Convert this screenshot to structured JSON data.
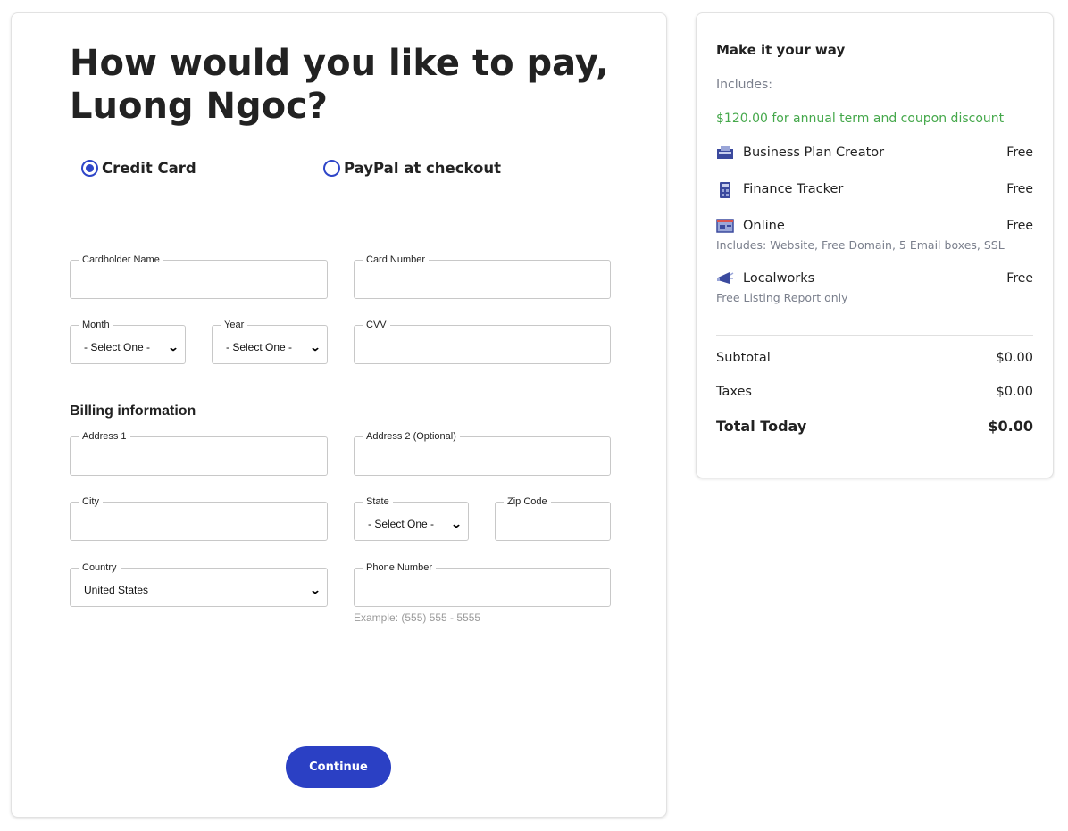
{
  "payment": {
    "title": "How would you like to pay, Luong Ngoc?",
    "methods": [
      {
        "label": "Credit Card",
        "selected": true
      },
      {
        "label": "PayPal at checkout",
        "selected": false
      }
    ],
    "card": {
      "cardholder_label": "Cardholder Name",
      "card_number_label": "Card Number",
      "month_label": "Month",
      "month_value": "- Select One -",
      "year_label": "Year",
      "year_value": "- Select One -",
      "cvv_label": "CVV"
    },
    "billing": {
      "title": "Billing information",
      "address1_label": "Address 1",
      "address2_label": "Address 2 (Optional)",
      "city_label": "City",
      "state_label": "State",
      "state_value": "- Select One -",
      "zip_label": "Zip Code",
      "country_label": "Country",
      "country_value": "United States",
      "phone_label": "Phone Number",
      "phone_hint": "Example: (555) 555 - 5555"
    },
    "continue_label": "Continue"
  },
  "summary": {
    "title": "Make it your way",
    "includes_label": "Includes:",
    "discount_text": "$120.00 for annual term and coupon discount",
    "items": [
      {
        "name": "Business Plan Creator",
        "price": "Free",
        "sub": "",
        "icon": "business-plan-icon"
      },
      {
        "name": "Finance Tracker",
        "price": "Free",
        "sub": "",
        "icon": "calculator-icon"
      },
      {
        "name": "Online",
        "price": "Free",
        "sub": "Includes: Website, Free Domain, 5 Email boxes, SSL",
        "icon": "website-icon"
      },
      {
        "name": "Localworks",
        "price": "Free",
        "sub": "Free Listing Report only",
        "icon": "megaphone-icon"
      }
    ],
    "subtotal_label": "Subtotal",
    "subtotal_value": "$0.00",
    "taxes_label": "Taxes",
    "taxes_value": "$0.00",
    "total_label": "Total Today",
    "total_value": "$0.00"
  },
  "colors": {
    "accent": "#2b40c4",
    "discount_green": "#45a84b",
    "muted_text": "#7a7f8c"
  }
}
